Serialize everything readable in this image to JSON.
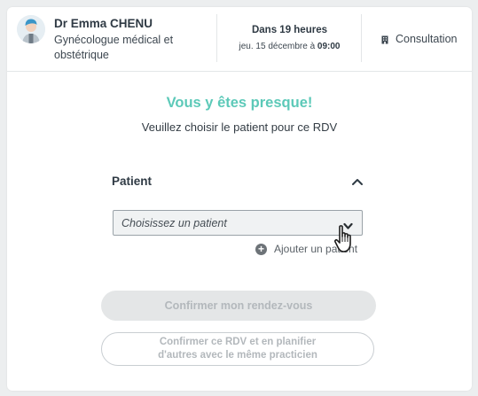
{
  "doctor": {
    "name": "Dr Emma CHENU",
    "specialty": "Gynécologue médical et obstétrique",
    "avatar_icon": "doctor-avatar-icon"
  },
  "appointment": {
    "relative": "Dans 19 heures",
    "date_prefix": "jeu. 15 décembre à ",
    "time": "09:00"
  },
  "consultation": {
    "icon": "building-icon",
    "label": "Consultation"
  },
  "main": {
    "title": "Vous y êtes presque!",
    "subtitle": "Veuillez choisir le patient pour ce RDV",
    "section_label": "Patient",
    "select_placeholder": "Choisissez un patient",
    "add_patient_label": "Ajouter un patient",
    "confirm_label": "Confirmer mon rendez-vous",
    "confirm_plan_line1": "Confirmer ce RDV et en planifier",
    "confirm_plan_line2": "d'autres avec le même practicien"
  },
  "colors": {
    "accent": "#5cc9b8",
    "disabled_text": "#b3b8bc",
    "disabled_bg": "#e4e6e7"
  }
}
